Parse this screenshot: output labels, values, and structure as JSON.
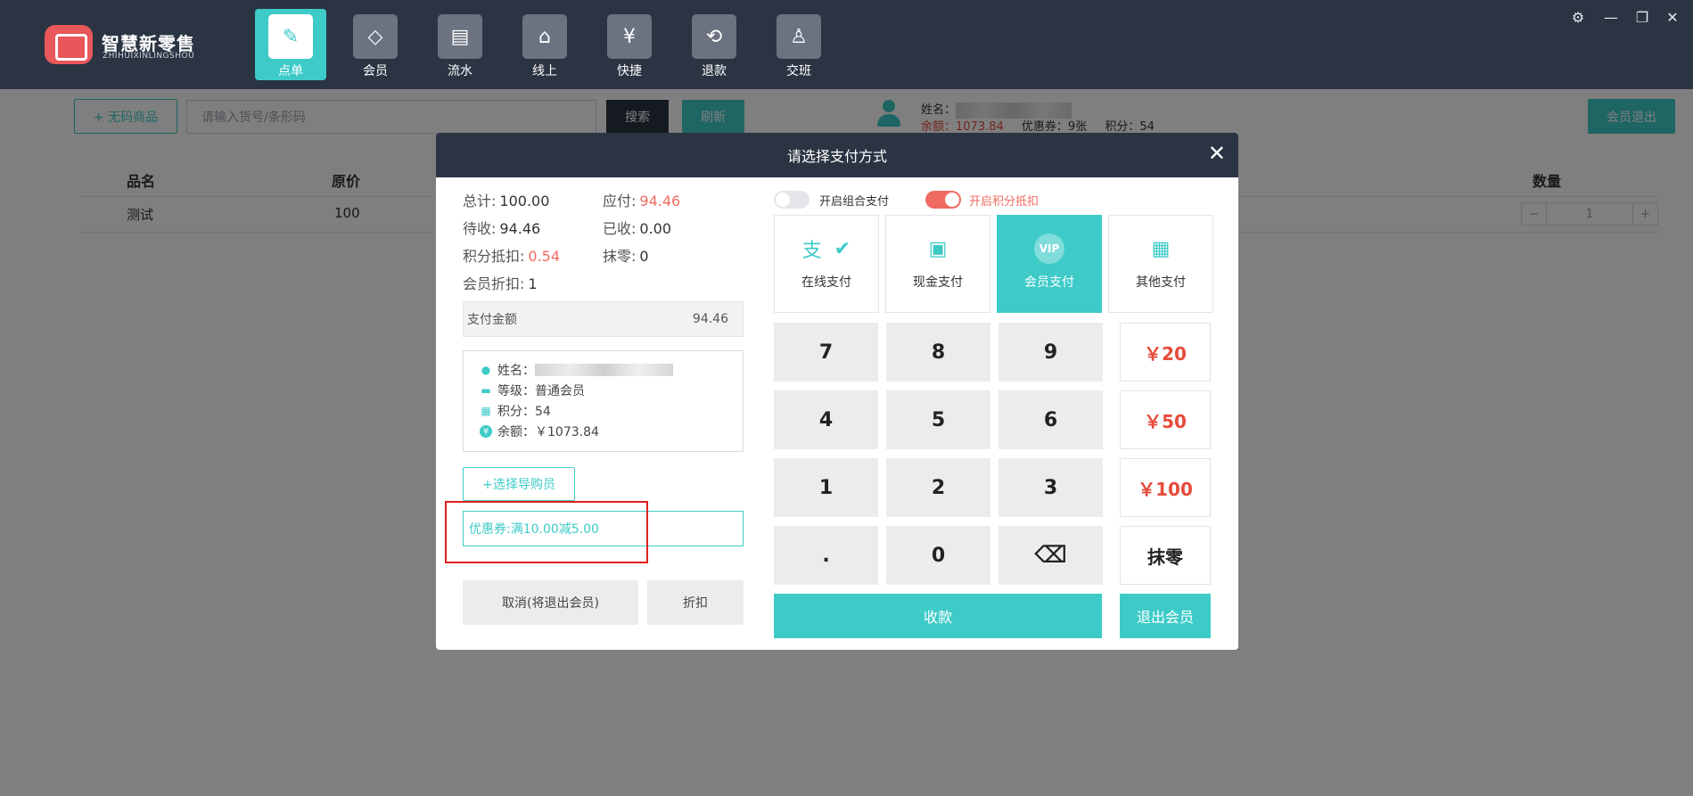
{
  "app": {
    "brand_cn": "智慧新零售",
    "brand_en": "ZHIHUIXINLINGSHOU"
  },
  "nav": [
    {
      "label": "点单",
      "icon": "pencil-icon",
      "glyph": "✎",
      "active": true
    },
    {
      "label": "会员",
      "icon": "diamond-icon",
      "glyph": "◇",
      "active": false
    },
    {
      "label": "流水",
      "icon": "receipt-icon",
      "glyph": "▤",
      "active": false
    },
    {
      "label": "线上",
      "icon": "store-icon",
      "glyph": "⌂",
      "active": false
    },
    {
      "label": "快捷",
      "icon": "quick-pay-icon",
      "glyph": "¥",
      "active": false
    },
    {
      "label": "退款",
      "icon": "refund-icon",
      "glyph": "⟲",
      "active": false
    },
    {
      "label": "交班",
      "icon": "handover-icon",
      "glyph": "♙",
      "active": false
    }
  ],
  "window_controls": {
    "settings": "⚙",
    "minimize": "—",
    "restore": "❐",
    "close": "✕"
  },
  "toolbar": {
    "no_code_btn": "+ 无码商品",
    "search_placeholder": "请输入货号/条形码",
    "search_btn": "搜索",
    "refresh_btn": "刷新",
    "member_logout_btn": "会员退出"
  },
  "member_bar": {
    "name_label": "姓名：",
    "balance_label": "余额：",
    "balance_value": "1073.84",
    "coupon_label": "优惠券：9张",
    "points_label": "积分：54"
  },
  "table": {
    "headers": [
      "品名",
      "原价",
      "数量"
    ],
    "rows": [
      {
        "name": "测试",
        "price": "100",
        "qty": "1"
      }
    ],
    "minus": "−",
    "plus": "+"
  },
  "modal": {
    "title": "请选择支付方式",
    "close": "✕",
    "summary": {
      "total_label": "总计:",
      "total_value": "100.00",
      "payable_label": "应付:",
      "payable_value": "94.46",
      "pending_label": "待收:",
      "pending_value": "94.46",
      "received_label": "已收:",
      "received_value": "0.00",
      "points_deduct_label": "积分抵扣:",
      "points_deduct_value": "0.54",
      "rounding_label": "抹零:",
      "rounding_value": "0",
      "member_discount_label": "会员折扣:",
      "member_discount_value": "1"
    },
    "pay_amount_label": "支付金额",
    "pay_amount_value": "94.46",
    "member_info": {
      "name_label": "姓名：",
      "level": "等级：普通会员",
      "points": "积分：54",
      "balance": "余额：￥1073.84"
    },
    "guide_btn": "+选择导购员",
    "coupon_text": "优惠券:满10.00减5.00",
    "cancel_btn": "取消(将退出会员)",
    "discount_btn": "折扣",
    "toggles": [
      {
        "label": "开启组合支付",
        "on": false
      },
      {
        "label": "开启积分抵扣",
        "on": true
      }
    ],
    "pay_types": [
      {
        "label": "在线支付",
        "icon": "online-pay-icon",
        "active": false
      },
      {
        "label": "现金支付",
        "icon": "wallet-icon",
        "active": false
      },
      {
        "label": "会员支付",
        "icon": "vip-icon",
        "badge": "VIP",
        "active": true
      },
      {
        "label": "其他支付",
        "icon": "grid-icon",
        "active": false
      }
    ],
    "keypad": [
      "7",
      "8",
      "9",
      "4",
      "5",
      "6",
      "1",
      "2",
      "3",
      ".",
      "0"
    ],
    "backspace_glyph": "⌫",
    "quick_amounts": [
      "￥20",
      "￥50",
      "￥100"
    ],
    "round_off_btn": "抹零",
    "collect_btn": "收款",
    "exit_member_btn": "退出会员"
  },
  "colors": {
    "accent": "#3ecbc8",
    "topbar": "#2b3443",
    "highlight_red": "#e02020",
    "amount_red": "#ef6b61"
  }
}
